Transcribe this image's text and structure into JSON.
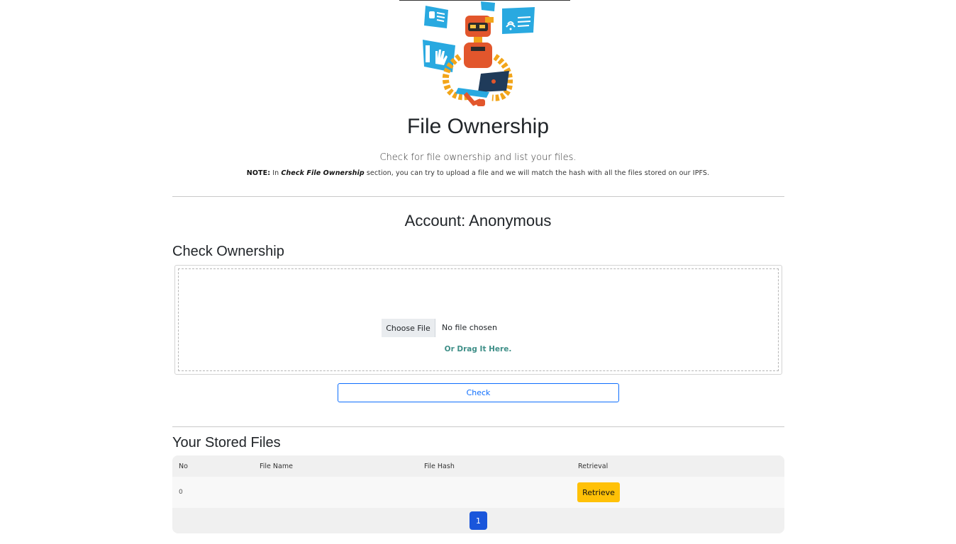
{
  "header": {
    "title": "File Ownership",
    "subtitle": "Check for file ownership and list your files.",
    "note_label": "NOTE:",
    "note_pre": " In ",
    "note_emphasis": "Check File Ownership",
    "note_post": " section, you can try to upload a file and we will match the hash with all the files stored on our IPFS."
  },
  "account": {
    "text": "Account: Anonymous"
  },
  "check_ownership": {
    "title": "Check Ownership",
    "choose_file_label": "Choose File",
    "file_status": "No file chosen",
    "drag_hint": "Or Drag It Here.",
    "check_button_label": "Check"
  },
  "stored_files": {
    "title": "Your Stored Files",
    "columns": [
      "No",
      "File Name",
      "File Hash",
      "Retrieval"
    ],
    "rows": [
      {
        "no": "0",
        "file_name": "",
        "file_hash": "",
        "retrieve_label": "Retrieve"
      }
    ],
    "pagination": {
      "current_page": "1"
    }
  },
  "colors": {
    "primary": "#0d6efd",
    "warning": "#ffc107",
    "drag_text": "#3f8f88",
    "page_active": "#1a56db"
  },
  "icons": {
    "hero": "robot-with-laptop-illustration"
  }
}
